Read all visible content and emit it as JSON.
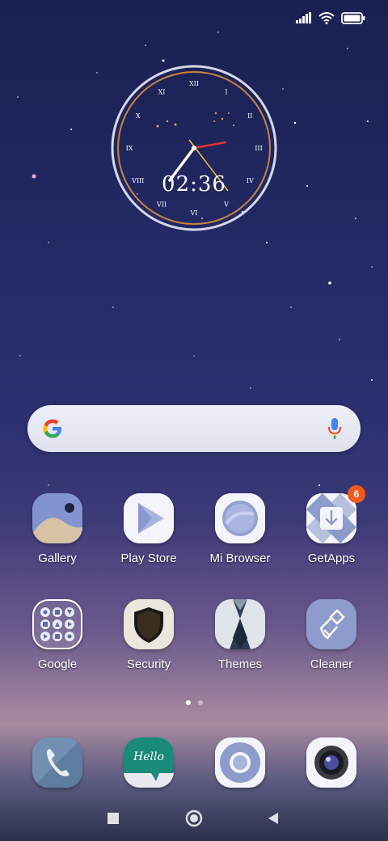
{
  "status_bar": {
    "icons": [
      "signal-icon",
      "wifi-icon",
      "battery-icon"
    ]
  },
  "clock_widget": {
    "time": "02:36",
    "numerals": [
      "XII",
      "I",
      "II",
      "III",
      "IV",
      "V",
      "VI",
      "VII",
      "VIII",
      "IX",
      "X",
      "XI"
    ],
    "accent": "#c8843f"
  },
  "search_bar": {
    "logo_icon": "google-g-icon",
    "mic_icon": "mic-icon"
  },
  "apps_row1": [
    {
      "label": "Gallery",
      "icon": "gallery-icon"
    },
    {
      "label": "Play Store",
      "icon": "play-store-icon"
    },
    {
      "label": "Mi Browser",
      "icon": "mi-browser-icon"
    },
    {
      "label": "GetApps",
      "icon": "getapps-icon",
      "badge": "6"
    }
  ],
  "apps_row2": [
    {
      "label": "Google",
      "icon": "google-folder-icon"
    },
    {
      "label": "Security",
      "icon": "security-shield-icon"
    },
    {
      "label": "Themes",
      "icon": "themes-icon"
    },
    {
      "label": "Cleaner",
      "icon": "cleaner-brush-icon"
    }
  ],
  "dock": [
    {
      "icon": "phone-icon"
    },
    {
      "icon": "messages-icon",
      "text": "Hello"
    },
    {
      "icon": "chrome-browser-icon"
    },
    {
      "icon": "camera-icon"
    }
  ],
  "page_indicator": {
    "pages": 2,
    "active": 1
  },
  "nav_bar": {
    "buttons": [
      "recents-square-icon",
      "home-circle-icon",
      "back-triangle-icon"
    ]
  },
  "colors": {
    "badge": "#f25a1d",
    "icon_bg": "#e8ebf5",
    "icon_accent": "#8e9ccc"
  }
}
